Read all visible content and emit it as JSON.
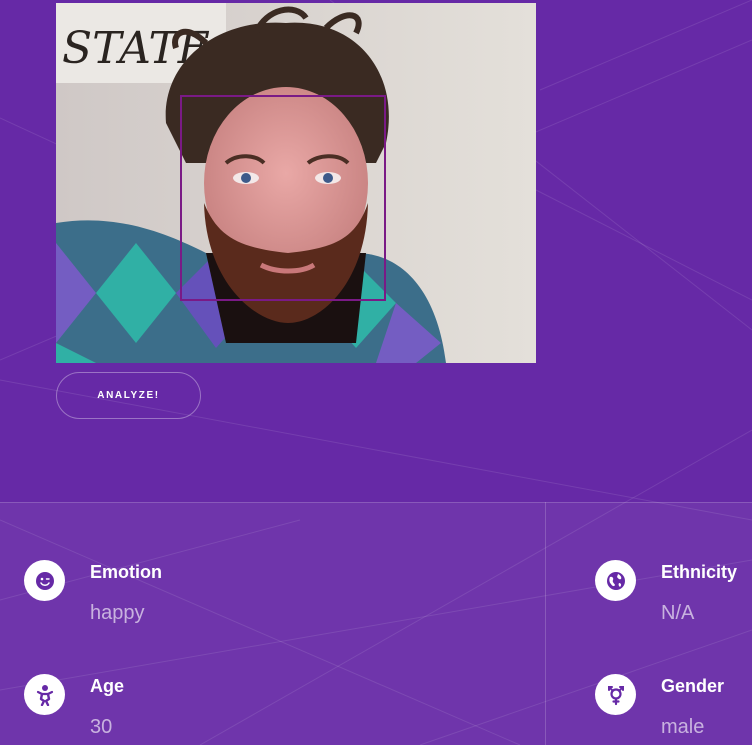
{
  "webcam": {
    "background_sign_text": "STATE",
    "face_box_color": "#7a1a86"
  },
  "actions": {
    "analyze_label": "ANALYZE!"
  },
  "results": {
    "emotion": {
      "label": "Emotion",
      "value": "happy",
      "icon": "smiley-wink-icon"
    },
    "age": {
      "label": "Age",
      "value": "30",
      "icon": "baby-icon"
    },
    "ethnicity": {
      "label": "Ethnicity",
      "value": "N/A",
      "icon": "globe-icon"
    },
    "gender": {
      "label": "Gender",
      "value": "male",
      "icon": "transgender-symbol-icon"
    }
  },
  "colors": {
    "background": "#6629a6",
    "icon_color": "#6629a6",
    "accent_white": "#ffffff"
  }
}
